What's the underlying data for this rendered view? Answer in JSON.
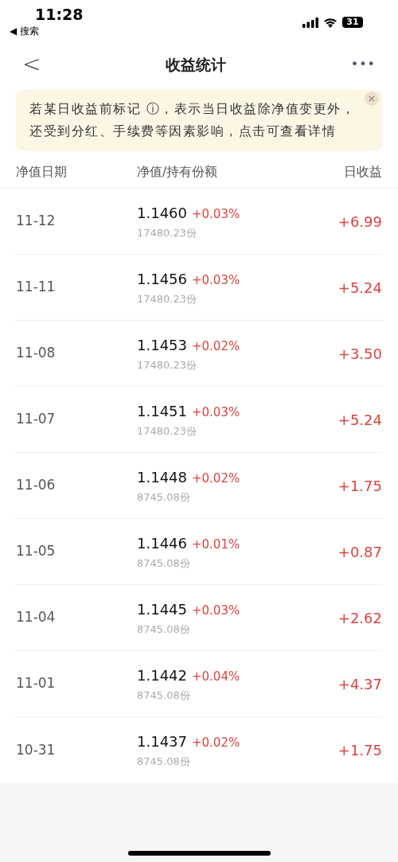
{
  "status_bar": {
    "time": "11:28",
    "back_label": "◀ 搜索",
    "battery": "31"
  },
  "nav": {
    "back": "<",
    "title": "收益统计",
    "more": "•••"
  },
  "notice": {
    "text": "若某日收益前标记 ⓘ，表示当日收益除净值变更外，还受到分红、手续费等因素影响，点击可查看详情",
    "close": "×"
  },
  "table": {
    "columns": [
      "净值日期",
      "净值/持有份额",
      "日收益"
    ],
    "rows": [
      {
        "date": "11-12",
        "nav": "1.1460",
        "change": "+0.03%",
        "shares": "17480.23份",
        "profit": "+6.99"
      },
      {
        "date": "11-11",
        "nav": "1.1456",
        "change": "+0.03%",
        "shares": "17480.23份",
        "profit": "+5.24"
      },
      {
        "date": "11-08",
        "nav": "1.1453",
        "change": "+0.02%",
        "shares": "17480.23份",
        "profit": "+3.50"
      },
      {
        "date": "11-07",
        "nav": "1.1451",
        "change": "+0.03%",
        "shares": "17480.23份",
        "profit": "+5.24"
      },
      {
        "date": "11-06",
        "nav": "1.1448",
        "change": "+0.02%",
        "shares": "8745.08份",
        "profit": "+1.75"
      },
      {
        "date": "11-05",
        "nav": "1.1446",
        "change": "+0.01%",
        "shares": "8745.08份",
        "profit": "+0.87"
      },
      {
        "date": "11-04",
        "nav": "1.1445",
        "change": "+0.03%",
        "shares": "8745.08份",
        "profit": "+2.62"
      },
      {
        "date": "11-01",
        "nav": "1.1442",
        "change": "+0.04%",
        "shares": "8745.08份",
        "profit": "+4.37"
      },
      {
        "date": "10-31",
        "nav": "1.1437",
        "change": "+0.02%",
        "shares": "8745.08份",
        "profit": "+1.75"
      }
    ]
  }
}
